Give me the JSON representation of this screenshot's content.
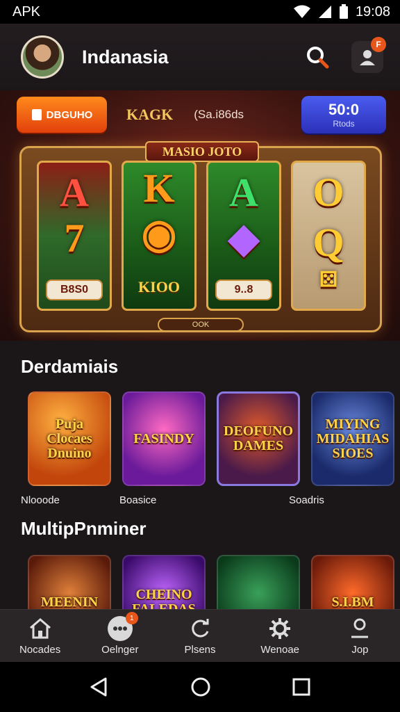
{
  "status_bar": {
    "carrier": "APK",
    "time": "19:08"
  },
  "header": {
    "app_name": "Indanasia",
    "notif_badge": "F"
  },
  "promo": {
    "left_button": "DBGUHO",
    "label_1": "KAGK",
    "label_2": "(Sa.i86ds",
    "right_button_big": "50:0",
    "right_button_small": "Rtods",
    "slot_title": "MASIO JOTO",
    "reel_1_badge": "B8S0",
    "reel_2_text": "KIOO",
    "reel_3_badge": "9..8",
    "slot_bottom": "OOK"
  },
  "sections": {
    "section_1_title": "Derdamiais",
    "section_2_title": "MultipPnminer"
  },
  "games_1": [
    {
      "tile_text": "Puja Clocaes Dnuino",
      "caption": "Nlooode"
    },
    {
      "tile_text": "FASINDY",
      "caption": "Boasice"
    },
    {
      "tile_text": "DEOFUNO DAMES",
      "caption": ""
    },
    {
      "tile_text": "MIYING MIDAHIAS SIOES",
      "caption": "Soadris"
    }
  ],
  "games_2": [
    {
      "tile_text": "MEENIN"
    },
    {
      "tile_text": "CHEINO FALEDAS"
    },
    {
      "tile_text": ""
    },
    {
      "tile_text": "S.I.BM"
    }
  ],
  "bottom_nav": [
    {
      "label": "Nocades",
      "icon": "home-icon"
    },
    {
      "label": "Oelnger",
      "icon": "chat-icon",
      "badge": "1"
    },
    {
      "label": "Plsens",
      "icon": "refresh-icon"
    },
    {
      "label": "Wenoae",
      "icon": "settings-icon"
    },
    {
      "label": "Jop",
      "icon": "profile-icon"
    }
  ],
  "colors": {
    "accent_orange": "#e8561c",
    "promo_blue": "#3a44d8",
    "background": "#1b1719"
  }
}
